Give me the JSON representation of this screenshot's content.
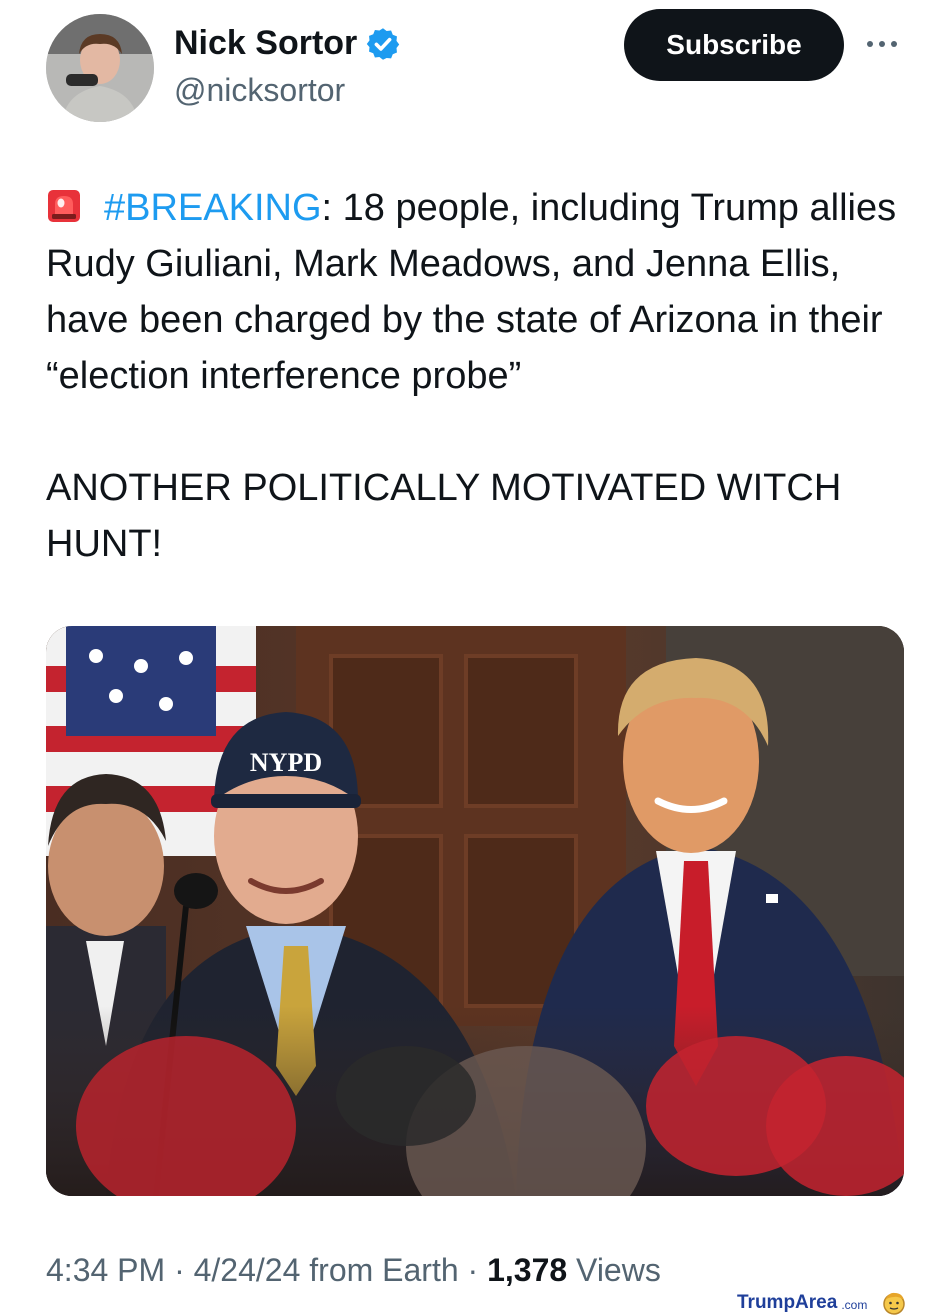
{
  "author": {
    "display_name": "Nick Sortor",
    "handle": "@nicksortor",
    "verified": true
  },
  "header": {
    "subscribe_label": "Subscribe"
  },
  "tweet": {
    "alarm_icon": "rotating-light-icon",
    "hashtag": "#BREAKING",
    "text_after_hashtag": ": 18 people, including Trump allies Rudy Giuliani, Mark Meadows, and Jenna Ellis, have been charged by the state of Arizona in their “election interference probe”",
    "second_paragraph": "ANOTHER POLITICALLY MOTIVATED WITCH HUNT!",
    "image_hat_text": "NYPD"
  },
  "meta": {
    "time": "4:34 PM",
    "date": "4/24/24",
    "source": "from Earth",
    "separator": " · ",
    "views_count": "1,378",
    "views_label": "Views"
  },
  "watermark": {
    "brand": "TrumpArea",
    "suffix": ".com"
  },
  "colors": {
    "link": "#1d9bf0",
    "text_primary": "#0f1419",
    "text_secondary": "#536471",
    "button_bg": "#0f1419",
    "verified_badge": "#1d9bf0"
  }
}
